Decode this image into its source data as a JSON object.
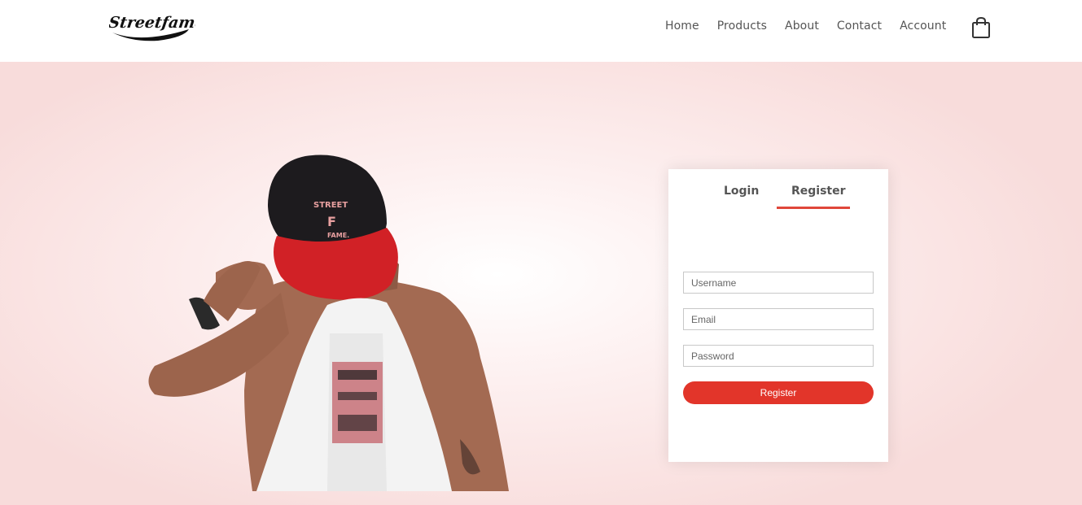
{
  "brand": {
    "logo_text": "Streetfame"
  },
  "nav": {
    "items": [
      "Home",
      "Products",
      "About",
      "Contact",
      "Account"
    ],
    "cart_icon": "shopping-bag-icon"
  },
  "hero": {
    "image": "model-wearing-red-black-cap-holding-white-tshirt"
  },
  "form": {
    "tabs": [
      {
        "label": "Login",
        "active": false
      },
      {
        "label": "Register",
        "active": true
      }
    ],
    "username_placeholder": "Username",
    "email_placeholder": "Email",
    "password_placeholder": "Password",
    "submit_label": "Register"
  },
  "colors": {
    "accent": "#e2352a",
    "tab_indicator": "#e0473a",
    "hero_bg": "#f8dcdb",
    "text": "#555555"
  }
}
